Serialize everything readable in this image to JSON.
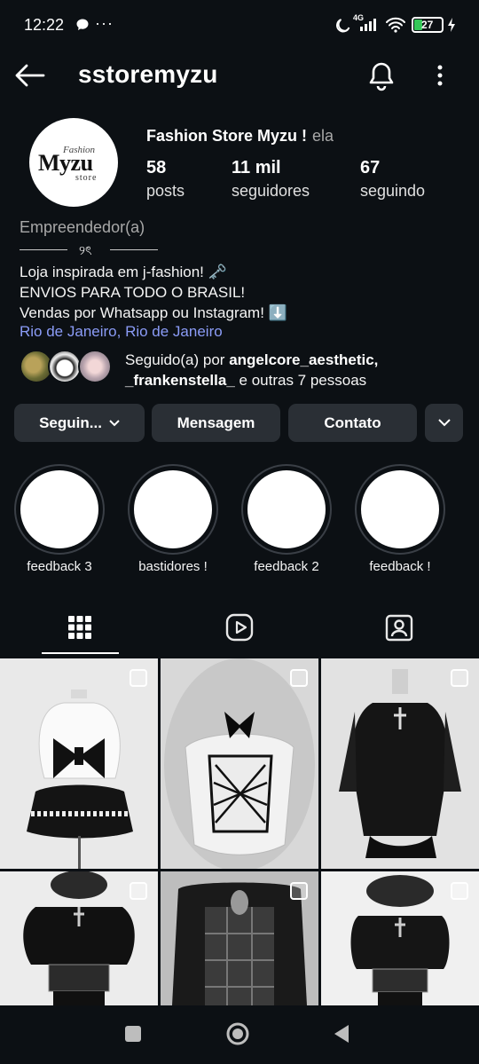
{
  "status_bar": {
    "time": "12:22",
    "dots": "···",
    "battery": "27",
    "net": "4G"
  },
  "header": {
    "username": "sstoremyzu"
  },
  "profile": {
    "logo_text": "Myzu",
    "logo_small_top": "Fashion",
    "logo_small_bottom": "store",
    "full_name": "Fashion Store Myzu !",
    "pronoun": "ela",
    "stats": [
      {
        "value": "58",
        "label": "posts"
      },
      {
        "value": "11 mil",
        "label": "seguidores"
      },
      {
        "value": "67",
        "label": "seguindo"
      }
    ],
    "category": "Empreendedor(a)",
    "divider_symbol": "୨ৎ",
    "bio_lines": [
      "Loja inspirada em j-fashion! 🗝️",
      "ENVIOS PARA TODO O BRASIL!",
      "Vendas por Whatsapp ou Instagram! ⬇️"
    ],
    "location": "Rio de Janeiro, Rio de Janeiro",
    "followed_by_prefix": "Seguido(a) por ",
    "followed_by_user1": "angelcore_aesthetic,",
    "followed_by_user2": "_frankenstella_",
    "followed_by_suffix": " e outras 7 pessoas"
  },
  "buttons": {
    "following": "Seguin...",
    "message": "Mensagem",
    "contact": "Contato"
  },
  "highlights": [
    {
      "label": "feedback 3"
    },
    {
      "label": "bastidores !"
    },
    {
      "label": "feedback 2"
    },
    {
      "label": "feedback !"
    }
  ],
  "tabs": [
    "grid-icon",
    "reels-icon",
    "tagged-icon"
  ],
  "colors": {
    "background": "#0c1014",
    "button": "#2a2f35",
    "link": "#8b9cf7",
    "muted": "#a8a8a8"
  }
}
